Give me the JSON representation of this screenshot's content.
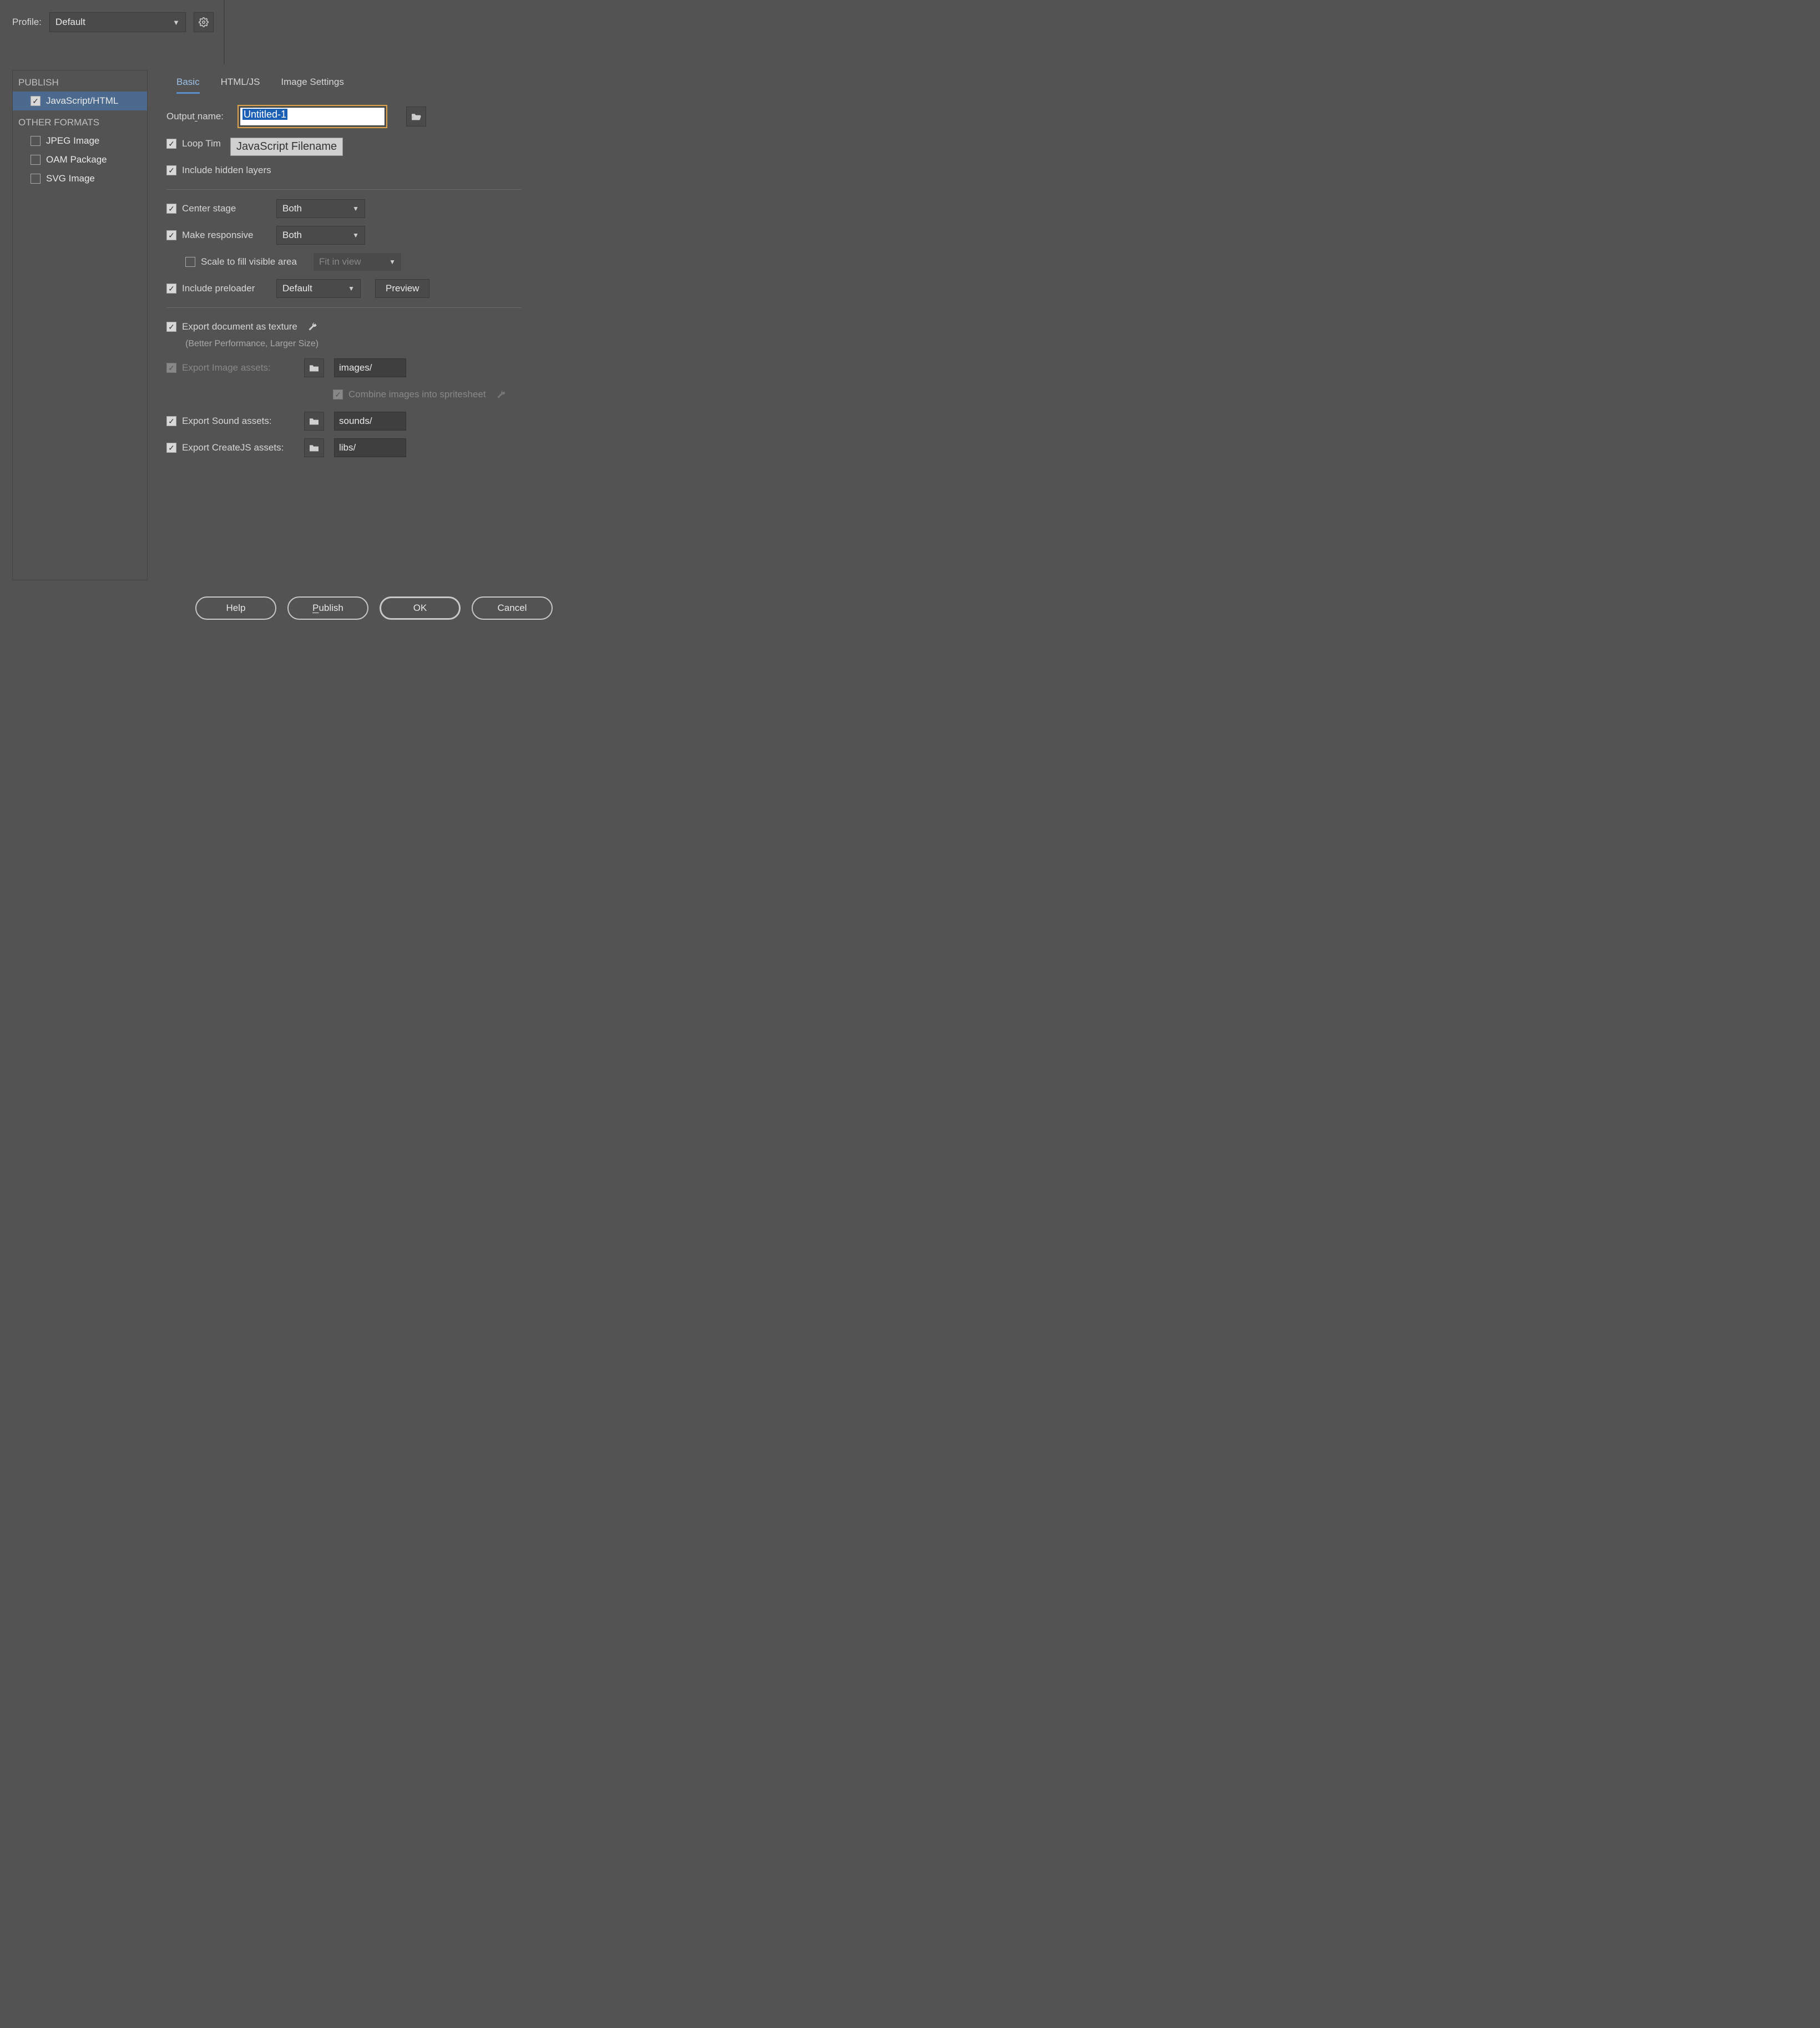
{
  "profile": {
    "label": "Profile:",
    "value": "Default"
  },
  "sidebar": {
    "publish_header": "PUBLISH",
    "other_header": "OTHER FORMATS",
    "items": {
      "js_html": "JavaScript/HTML",
      "jpeg": "JPEG Image",
      "oam": "OAM Package",
      "svg": "SVG Image"
    }
  },
  "tabs": {
    "basic": "Basic",
    "htmljs": "HTML/JS",
    "image": "Image Settings"
  },
  "output": {
    "label": "Output name:",
    "value": "Untitled-1",
    "tooltip": "JavaScript Filename"
  },
  "options": {
    "loop_timeline": "Loop Timeline",
    "include_hidden": "Include hidden layers",
    "center_stage": "Center stage",
    "center_stage_value": "Both",
    "make_responsive": "Make responsive",
    "make_responsive_value": "Both",
    "scale_fill": "Scale to fill visible area",
    "scale_fill_value": "Fit in view",
    "include_preloader": "Include preloader",
    "preloader_value": "Default",
    "preview_btn": "Preview",
    "export_texture": "Export document as texture",
    "export_texture_note": "(Better Performance, Larger Size)",
    "export_image_assets": "Export Image assets:",
    "images_path": "images/",
    "combine_spritesheet": "Combine images into spritesheet",
    "export_sound": "Export Sound assets:",
    "sounds_path": "sounds/",
    "export_createjs": "Export CreateJS assets:",
    "libs_path": "libs/"
  },
  "footer": {
    "help": "Help",
    "publish": "Publish",
    "ok": "OK",
    "cancel": "Cancel"
  }
}
